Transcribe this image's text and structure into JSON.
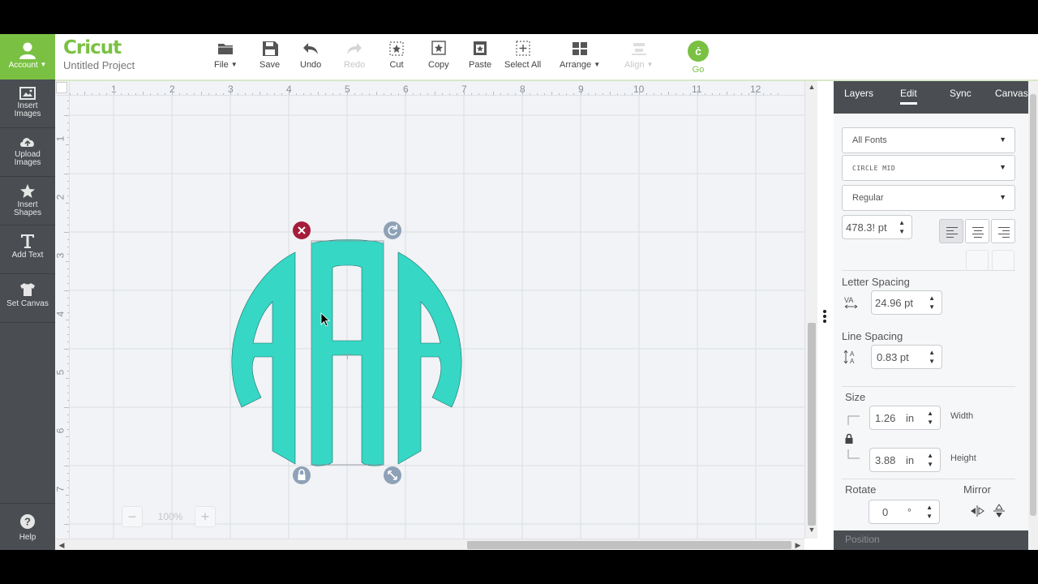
{
  "sidebar": {
    "account_label": "Account",
    "items": [
      {
        "label1": "Insert",
        "label2": "Images"
      },
      {
        "label1": "Upload",
        "label2": "Images"
      },
      {
        "label1": "Insert",
        "label2": "Shapes"
      },
      {
        "label1": "Add Text",
        "label2": ""
      },
      {
        "label1": "Set Canvas",
        "label2": ""
      }
    ],
    "help_label": "Help"
  },
  "header": {
    "logo_text": "Cricut",
    "project_name": "Untitled Project"
  },
  "toolbar": {
    "file": "File",
    "save": "Save",
    "undo": "Undo",
    "redo": "Redo",
    "cut": "Cut",
    "copy": "Copy",
    "paste": "Paste",
    "select_all": "Select All",
    "arrange": "Arrange",
    "align": "Align",
    "go": "Go",
    "go_glyph": "ċ"
  },
  "canvas": {
    "ruler_h": [
      "1",
      "2",
      "3",
      "4",
      "5",
      "6",
      "7",
      "8",
      "9",
      "10",
      "11",
      "12"
    ],
    "ruler_v": [
      "1",
      "2",
      "3",
      "4",
      "5",
      "6",
      "7"
    ],
    "zoom_value": "100%",
    "monogram_text": "AAA",
    "monogram_color": "#36d7c5"
  },
  "panel": {
    "tabs": [
      "Layers",
      "Edit",
      "Sync",
      "Canvas"
    ],
    "active_tab": "Edit",
    "font_filter": "All Fonts",
    "font_name": "CIRCLE MID",
    "font_style": "Regular",
    "font_size": "478.3! pt",
    "letter_spacing_label": "Letter Spacing",
    "letter_spacing_value": "24.96 pt",
    "line_spacing_label": "Line Spacing",
    "line_spacing_value": "0.83  pt",
    "size_label": "Size",
    "width_value": "1.26",
    "height_value": "3.88",
    "unit": "in",
    "width_label": "Width",
    "height_label": "Height",
    "rotate_label": "Rotate",
    "rotate_value": "0",
    "degree": "°",
    "mirror_label": "Mirror",
    "position_label": "Position"
  }
}
